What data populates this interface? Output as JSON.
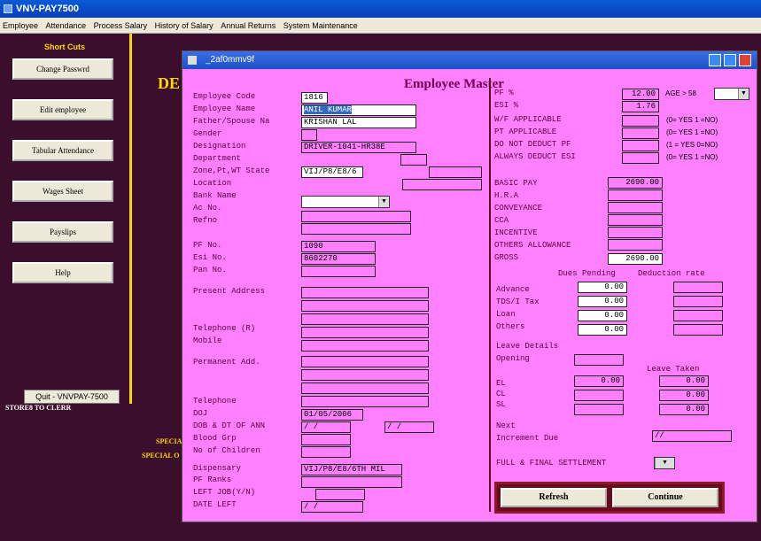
{
  "app": {
    "title": "VNV-PAY7500"
  },
  "menu": [
    "Employee",
    "Attendance",
    "Process Salary",
    "History of Salary",
    "Annual Returns",
    "System Maintenance"
  ],
  "sidebar": {
    "heading": "Short Cuts",
    "buttons": [
      "Change Passwrd",
      "Edit employee",
      "Tabular Attendance",
      "Wages Sheet",
      "Payslips",
      "Help"
    ],
    "quit": "Quit - VNVPAY-7500",
    "store": "STORE8 TO CLERR"
  },
  "background": {
    "de": "DE",
    "special1": "SPECIA",
    "special2": "SPECIAL O"
  },
  "window": {
    "title": "_2af0mmv9f",
    "form_title": "Employee Master"
  },
  "left": {
    "employee_code": {
      "label": "Employee Code",
      "value": "1816"
    },
    "employee_name": {
      "label": "Employee Name",
      "value": "ANIL KUMAR"
    },
    "father": {
      "label": "Father/Spouse Na",
      "value": "KRISHAN LAL"
    },
    "gender": {
      "label": "Gender",
      "value": ""
    },
    "designation": {
      "label": "Designation",
      "value": "DRIVER-1041-HR38E"
    },
    "department": {
      "label": "Department",
      "value": ""
    },
    "zone": {
      "label": "Zone,Pt,WT State",
      "value": "VIJ/P8/E8/6"
    },
    "location": {
      "label": "Location",
      "value": ""
    },
    "bank": {
      "label": "Bank Name",
      "value": ""
    },
    "acno": {
      "label": "Ac No.",
      "value": ""
    },
    "refno": {
      "label": "Refno",
      "value": ""
    },
    "pfno": {
      "label": "PF No.",
      "value": "1090"
    },
    "esino": {
      "label": "Esi No.",
      "value": "8602270"
    },
    "panno": {
      "label": "Pan No.",
      "value": ""
    },
    "present": {
      "label": "Present Address"
    },
    "telephone_r": {
      "label": "Telephone (R)"
    },
    "mobile": {
      "label": "Mobile"
    },
    "permanent": {
      "label": "Permanent Add."
    },
    "telephone": {
      "label": "Telephone"
    },
    "doj": {
      "label": "DOJ",
      "value": "01/05/2006"
    },
    "dob": {
      "label": "DOB & DT OF ANN",
      "value1": "/ /",
      "value2": "/ /"
    },
    "blood": {
      "label": "Blood Grp"
    },
    "children": {
      "label": "No of Children"
    },
    "dispensary": {
      "label": "Dispensary",
      "value": "VIJ/P8/E8/6TH MIL"
    },
    "pfranks": {
      "label": "PF Ranks"
    },
    "leftjob": {
      "label": "LEFT JOB(Y/N)"
    },
    "dateleft": {
      "label": "DATE LEFT",
      "value": "/ /"
    }
  },
  "right": {
    "pf": {
      "label": "PF %",
      "value": "12.00"
    },
    "esi": {
      "label": "ESI %",
      "value": "1.76"
    },
    "age": {
      "label": "AGE > 58"
    },
    "wf": {
      "label": "W/F APPLICABLE",
      "hint": "(0= YES 1 =NO)"
    },
    "pt": {
      "label": "PT APPLICABLE",
      "hint": "(0= YES 1 =NO)"
    },
    "dndpf": {
      "label": "DO NOT DEDUCT PF",
      "hint": "(1 = YES 0=NO)"
    },
    "ade": {
      "label": "ALWAYS DEDUCT ESI",
      "hint": "(0= YES 1 =NO)"
    },
    "basic": {
      "label": "BASIC PAY",
      "value": "2690.00"
    },
    "hra": {
      "label": "H.R.A"
    },
    "conv": {
      "label": "CONVEYANCE"
    },
    "cca": {
      "label": "CCA"
    },
    "inc": {
      "label": "INCENTIVE"
    },
    "others": {
      "label": "OTHERS ALLOWANCE"
    },
    "gross": {
      "label": "GROSS",
      "value": "2690.00"
    },
    "dues_header": "Dues Pending",
    "ded_header": "Deduction rate",
    "advance": {
      "label": "Advance",
      "value": "0.00"
    },
    "tds": {
      "label": "TDS/I Tax",
      "value": "0.00"
    },
    "loan": {
      "label": "Loan",
      "value": "0.00"
    },
    "others2": {
      "label": "Others",
      "value": "0.00"
    },
    "leave_details": "Leave Details",
    "opening": "Opening",
    "leave_taken": "Leave Taken",
    "el": {
      "label": "EL",
      "value": "0.00",
      "taken": "0.00"
    },
    "cl": {
      "label": "CL",
      "taken": "0.00"
    },
    "sl": {
      "label": "SL",
      "taken": "0.00"
    },
    "next": "Next",
    "incr": {
      "label": "Increment Due",
      "value": "//"
    },
    "ffs": {
      "label": "FULL & FINAL SETTLEMENT"
    },
    "refresh": "Refresh",
    "continue": "Continue"
  }
}
